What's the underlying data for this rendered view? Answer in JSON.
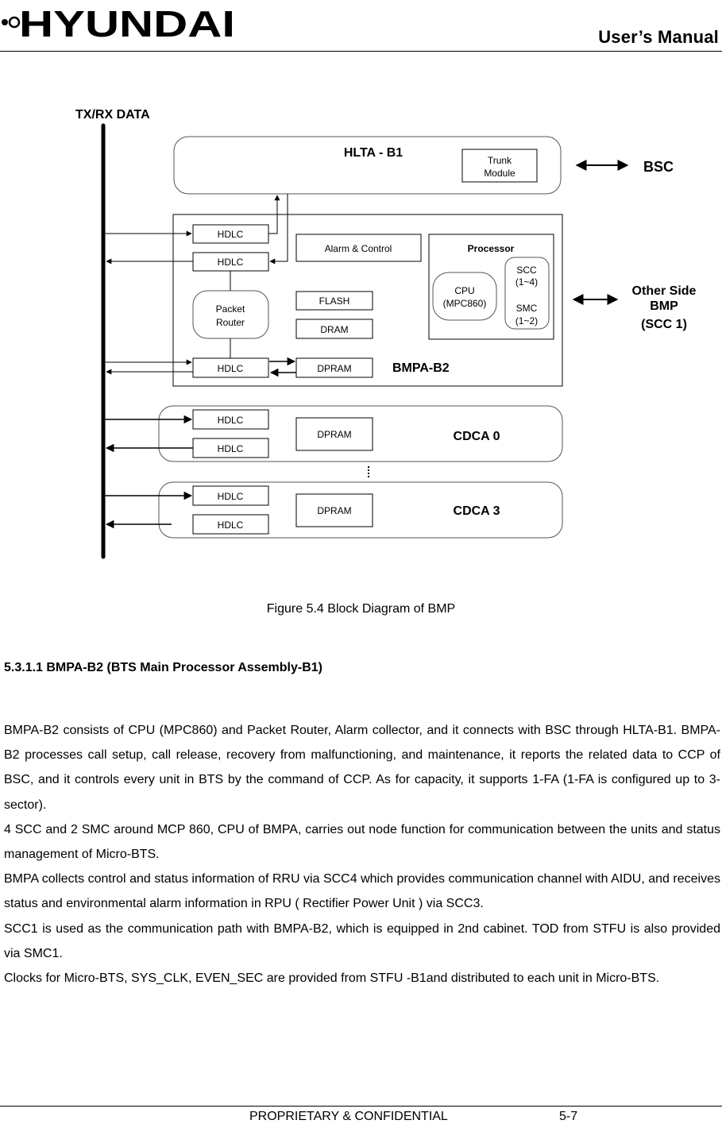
{
  "header": {
    "brand": "HYUNDAI",
    "manual_title": "User’s Manual"
  },
  "diagram": {
    "bus_label": "TX/RX DATA",
    "hlta": {
      "title": "HLTA - B1",
      "trunk_module_line1": "Trunk",
      "trunk_module_line2": "Module"
    },
    "bsc_label": "BSC",
    "bmpa": {
      "title": "BMPA-B2",
      "hdlc_top": "HDLC",
      "hdlc_mid": "HDLC",
      "hdlc_bottom": "HDLC",
      "packet_router_line1": "Packet",
      "packet_router_line2": "Router",
      "alarm_control": "Alarm & Control",
      "flash": "FLASH",
      "dram": "DRAM",
      "dpram": "DPRAM",
      "processor": {
        "title": "Processor",
        "cpu_line1": "CPU",
        "cpu_line2": "(MPC860)",
        "scc_line1": "SCC",
        "scc_line2": "(1~4)",
        "smc_line1": "SMC",
        "smc_line2": "(1~2)"
      }
    },
    "other_side": {
      "line1": "Other Side",
      "line2": "BMP",
      "line3": "(SCC 1)"
    },
    "cdca": [
      {
        "title": "CDCA 0",
        "hdlc_in": "HDLC",
        "hdlc_out": "HDLC",
        "dpram": "DPRAM"
      },
      {
        "title": "CDCA 3",
        "hdlc_in": "HDLC",
        "hdlc_out": "HDLC",
        "dpram": "DPRAM"
      }
    ]
  },
  "caption": "Figure 5.4 Block Diagram of BMP",
  "section": {
    "number": "5.3.1.1",
    "heading": "5.3.1.1  BMPA-B2 (BTS Main Processor Assembly-B1)"
  },
  "paragraphs": [
    "BMPA-B2 consists of CPU (MPC860) and Packet Router, Alarm collector, and it connects with BSC through HLTA-B1. BMPA-B2 processes call setup, call release, recovery from malfunctioning, and maintenance, it reports the related data to CCP of BSC, and it controls every unit in BTS by the command of CCP. As for capacity, it supports 1-FA (1-FA is configured up to 3-sector).",
    "4 SCC and 2 SMC around MCP 860, CPU of BMPA, carries out node function for communication between the units and status management of Micro-BTS.",
    "BMPA collects control and status information of RRU via SCC4 which provides communication channel with AIDU, and receives status and environmental alarm information in RPU ( Rectifier Power Unit ) via SCC3.",
    "SCC1 is used as the communication path with BMPA-B2, which is equipped in 2nd cabinet. TOD from STFU is also provided via SMC1.",
    "Clocks for Micro-BTS, SYS_CLK, EVEN_SEC are provided from STFU -B1and distributed to each unit in Micro-BTS."
  ],
  "footer": {
    "confidential": "PROPRIETARY & CONFIDENTIAL",
    "page_number": "5-7"
  }
}
